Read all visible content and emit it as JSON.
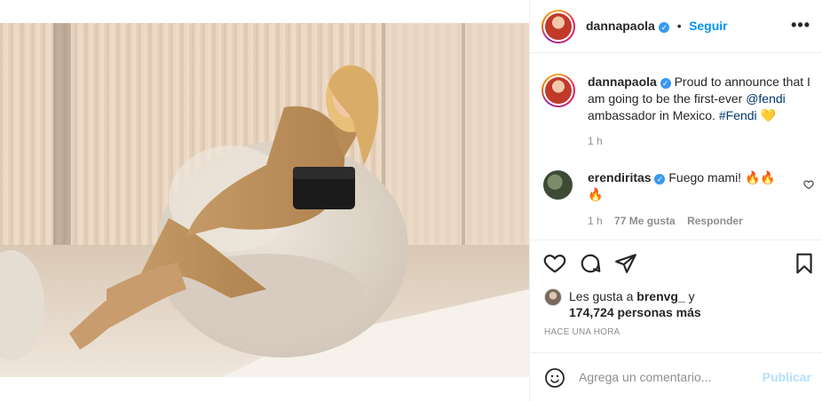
{
  "post": {
    "author": "dannapaola",
    "follow_label": "Seguir",
    "separator": "•",
    "more_label": "•••",
    "image_alt": "Danna Paola sitting on a beige armchair, Fendi campaign photo"
  },
  "caption": {
    "username": "dannapaola",
    "text_before": "Proud to announce that I am going to be the first-ever ",
    "mention": "@fendi",
    "text_middle": " ambassador in Mexico. ",
    "hashtag": "#Fendi",
    "emoji": "💛",
    "time": "1 h"
  },
  "comment": {
    "username": "erendiritas",
    "text": "Fuego mami! 🔥🔥🔥",
    "time": "1 h",
    "likes": "77 Me gusta",
    "reply_label": "Responder"
  },
  "likes": {
    "prefix": "Les gusta a ",
    "user": "brenvg_",
    "conjunction": " y",
    "count": "174,724 personas más"
  },
  "timestamp": "Hace una hora",
  "comment_box": {
    "placeholder": "Agrega un comentario...",
    "publish_label": "Publicar"
  },
  "icons": {
    "verified": "verified-badge-icon",
    "like": "heart-icon",
    "comment": "comment-bubble-icon",
    "share": "paper-plane-icon",
    "save": "bookmark-icon",
    "emoji": "smiley-icon",
    "more": "ellipsis-icon"
  },
  "colors": {
    "accent": "#0095f6",
    "verified": "#3897f0",
    "link": "#00376b",
    "muted": "#8e8e8e",
    "publish_disabled": "#b2dffc"
  }
}
